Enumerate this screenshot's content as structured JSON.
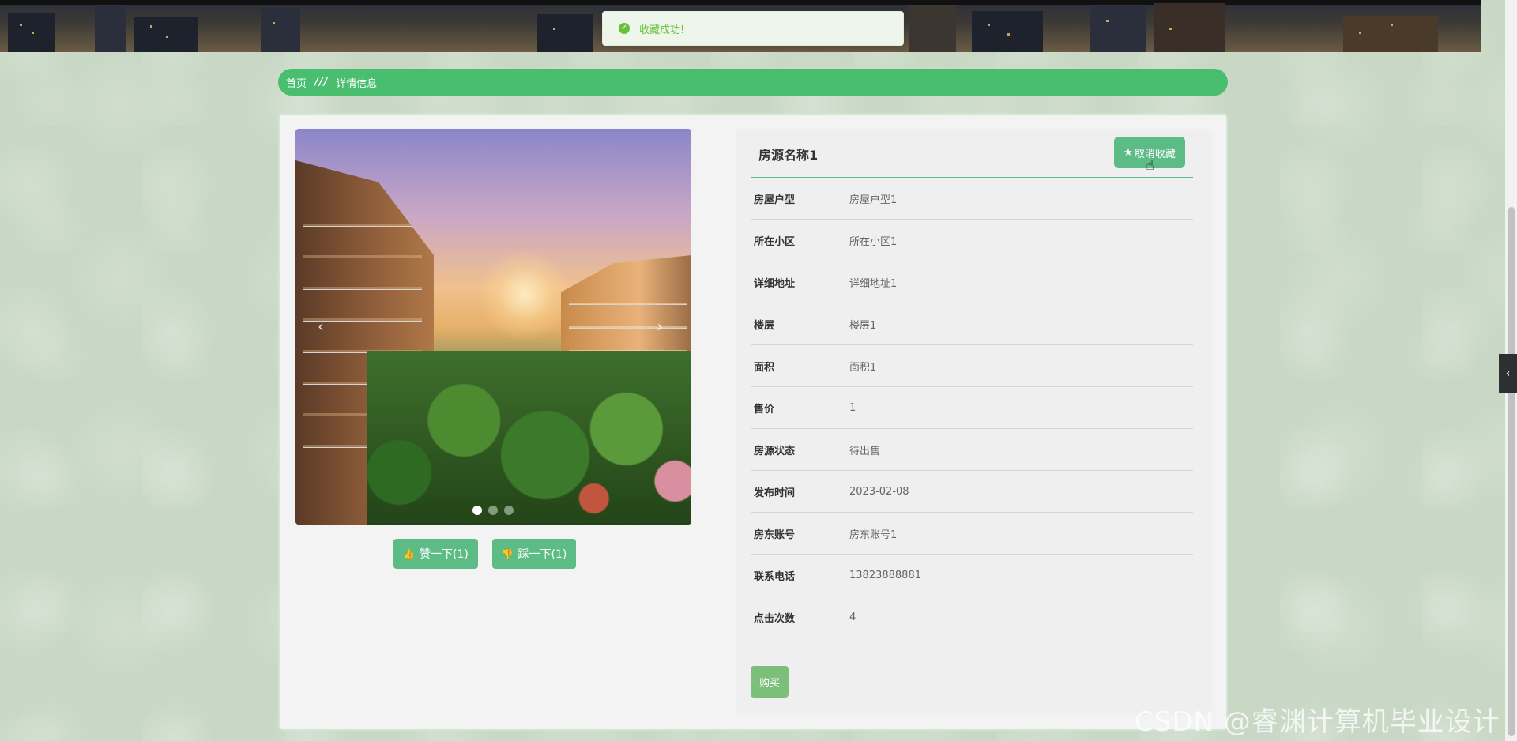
{
  "toast": {
    "message": "收藏成功!"
  },
  "breadcrumb": {
    "home": "首页",
    "separator": "///",
    "current": "详情信息"
  },
  "carousel": {
    "prev_icon": "‹",
    "next_icon": "›",
    "slide_count": 3,
    "active_slide": 1
  },
  "votes": {
    "like_label": "赞一下(1)",
    "dislike_label": "踩一下(1)",
    "like_icon": "👍",
    "dislike_icon": "👎"
  },
  "detail": {
    "title": "房源名称1",
    "fav_label": "取消收藏",
    "fav_icon": "★",
    "fields": [
      {
        "label": "房屋户型",
        "value": "房屋户型1"
      },
      {
        "label": "所在小区",
        "value": "所在小区1"
      },
      {
        "label": "详细地址",
        "value": "详细地址1"
      },
      {
        "label": "楼层",
        "value": "楼层1"
      },
      {
        "label": "面积",
        "value": "面积1"
      },
      {
        "label": "售价",
        "value": "1"
      },
      {
        "label": "房源状态",
        "value": "待出售"
      },
      {
        "label": "发布时间",
        "value": "2023-02-08"
      },
      {
        "label": "房东账号",
        "value": "房东账号1"
      },
      {
        "label": "联系电话",
        "value": "13823888881"
      },
      {
        "label": "点击次数",
        "value": "4"
      }
    ],
    "buy_label": "购买"
  },
  "side_tab": {
    "icon": "‹"
  },
  "watermark": "CSDN @睿渊计算机毕业设计",
  "colors": {
    "accent": "#5dbb86",
    "breadcrumb": "#48be6e",
    "toast_text": "#67c23a",
    "buy": "#7cbf7a"
  }
}
